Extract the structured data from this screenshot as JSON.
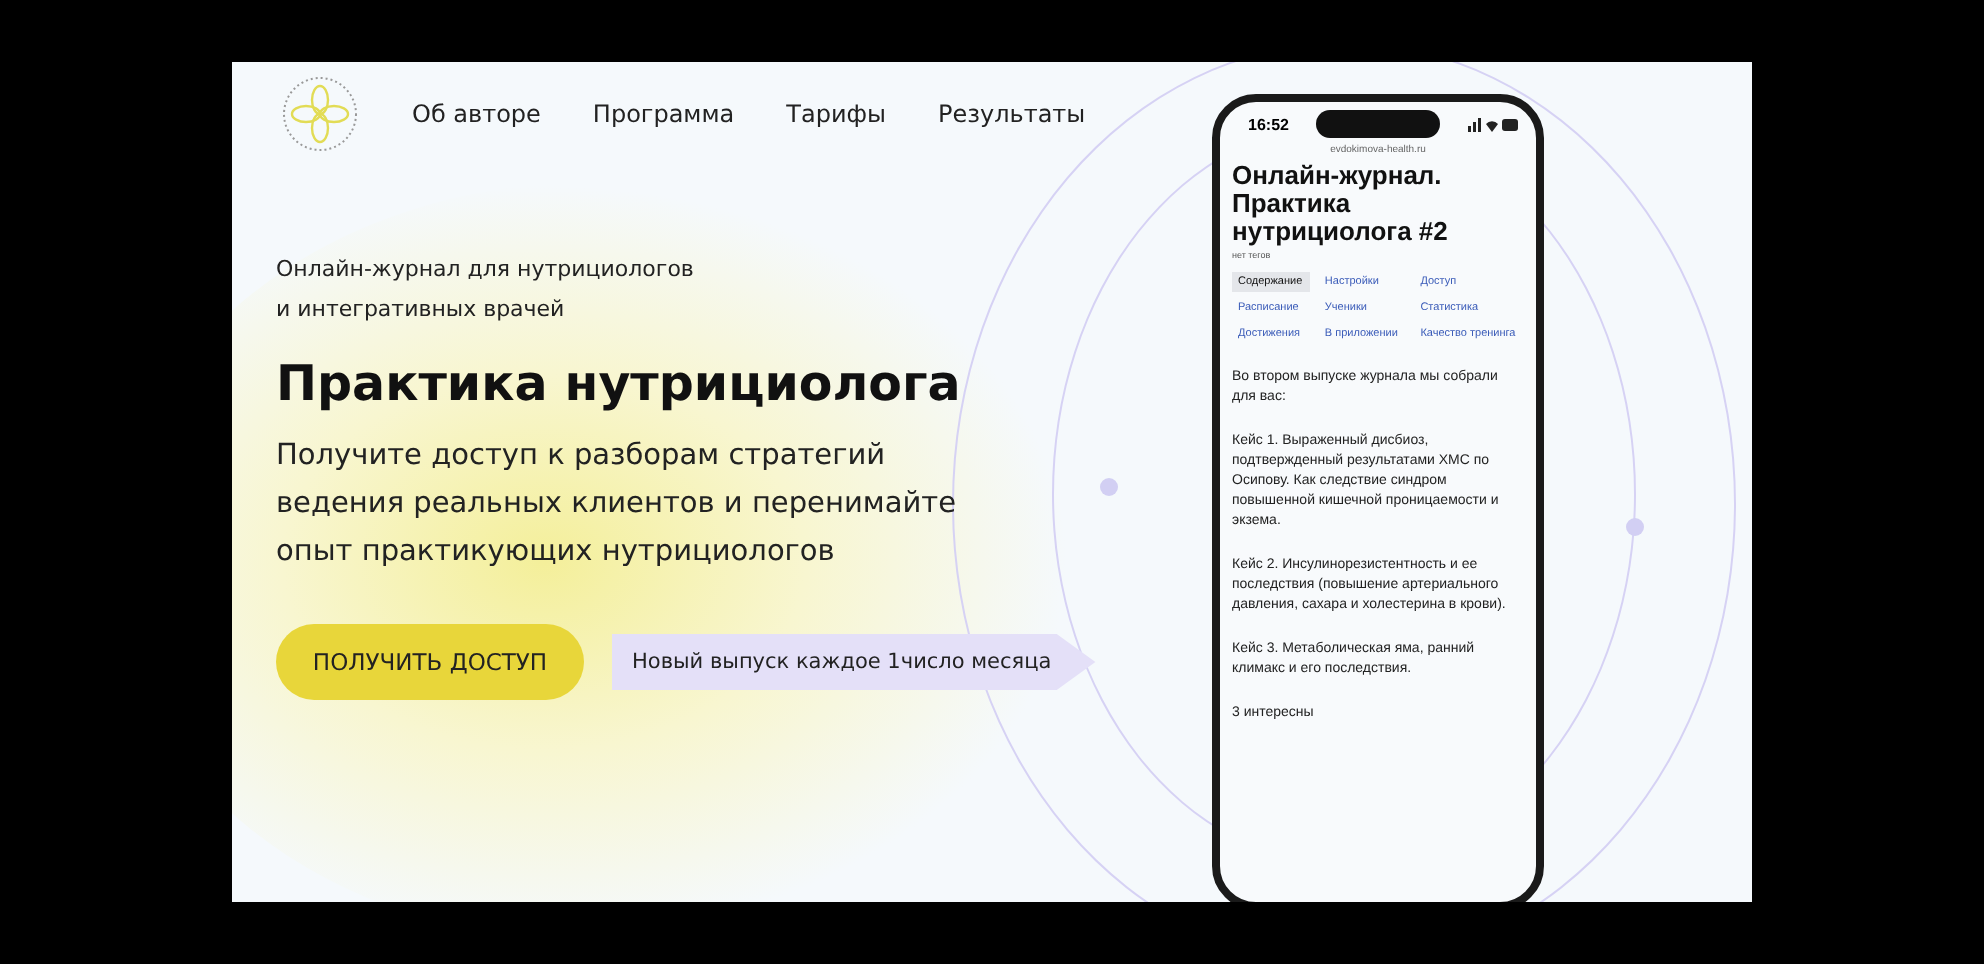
{
  "nav": {
    "items": [
      "Об авторе",
      "Программа",
      "Тарифы",
      "Результаты"
    ]
  },
  "hero": {
    "subtitle": "Онлайн-журнал для нутрициологов и интегративных врачей",
    "title": "Практика нутрициолога",
    "lead": "Получите доступ к разборам стратегий ведения реальных клиентов и перенимайте опыт практикующих нутрициологов",
    "cta": "ПОЛУЧИТЬ ДОСТУП",
    "note": "Новый выпуск каждое 1число месяца"
  },
  "phone": {
    "time": "16:52",
    "url": "evdokimova-health.ru",
    "title": "Онлайн-журнал. Практика нутрициолога #2",
    "tags": "нет тегов",
    "tabs": [
      {
        "label": "Содержание",
        "selected": true
      },
      {
        "label": "Настройки",
        "selected": false
      },
      {
        "label": "Доступ",
        "selected": false
      },
      {
        "label": "Расписание",
        "selected": false
      },
      {
        "label": "Ученики",
        "selected": false
      },
      {
        "label": "Статистика",
        "selected": false
      },
      {
        "label": "Достижения",
        "selected": false
      },
      {
        "label": "В приложении",
        "selected": false
      },
      {
        "label": "Качество тренинга",
        "selected": false
      }
    ],
    "paragraphs": [
      "Во втором выпуске журнала мы собрали для вас:",
      "Кейс 1. Выраженный дисбиоз, подтвержденный результатами ХМС по Осипову. Как следствие синдром повышенной кишечной проницаемости и экзема.",
      "Кейс 2. Инсулинорезистентность и ее последствия (повышение артериального давления, сахара и холестерина в крови).",
      "Кейс 3. Метаболическая яма, ранний климакс и его последствия.",
      "3 интересны"
    ]
  }
}
